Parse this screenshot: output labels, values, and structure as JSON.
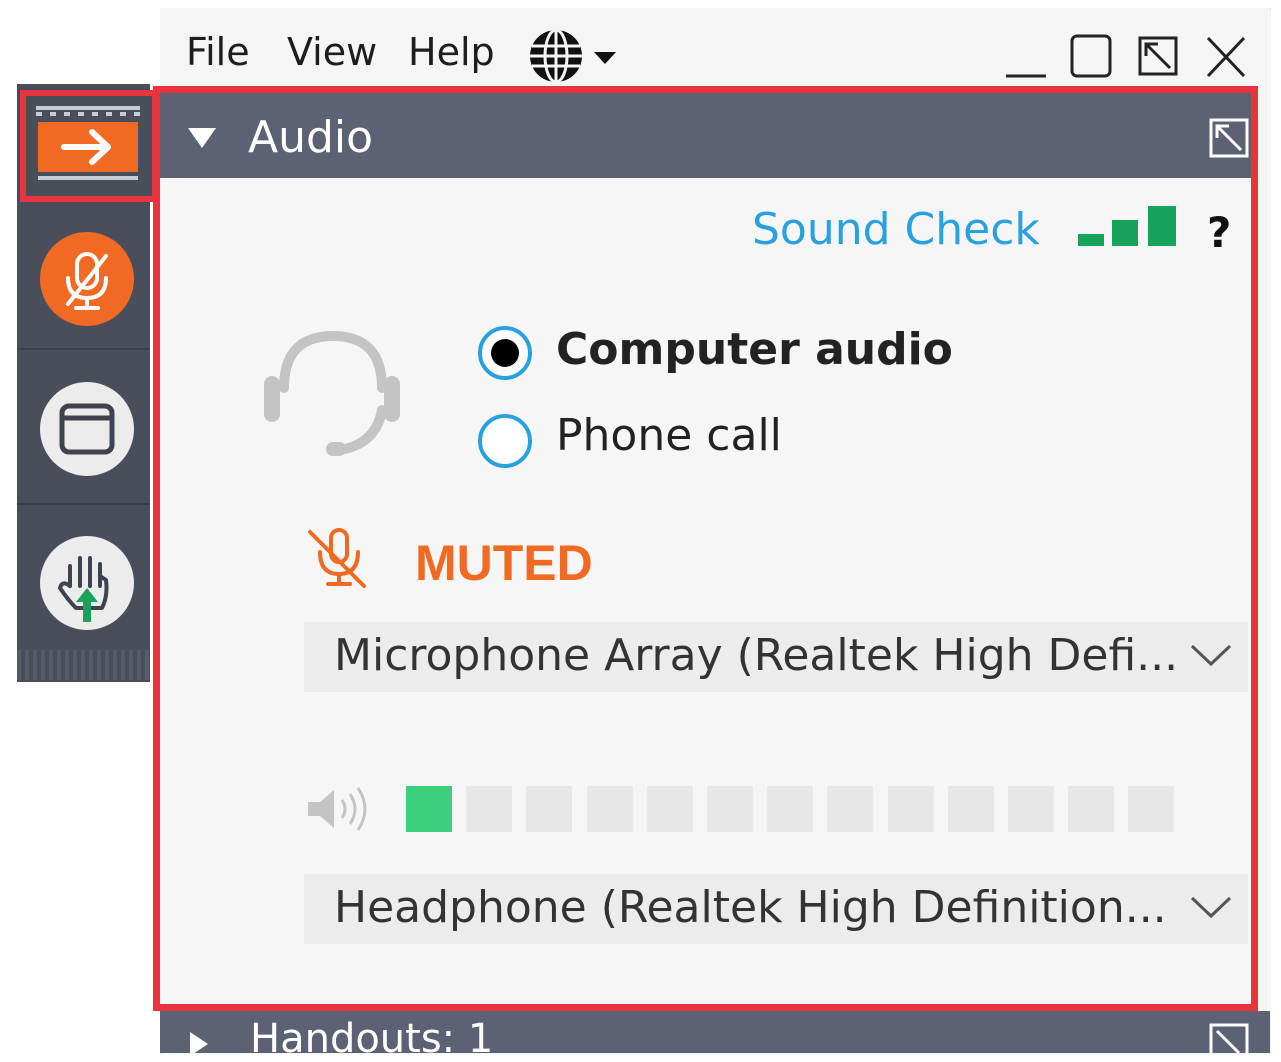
{
  "menubar": {
    "items": [
      "File",
      "View",
      "Help"
    ]
  },
  "audio_panel": {
    "title": "Audio",
    "sound_check_label": "Sound Check",
    "help_label": "?",
    "options": [
      {
        "label": "Computer audio",
        "selected": true
      },
      {
        "label": "Phone call",
        "selected": false
      }
    ],
    "mute_status": "MUTED",
    "microphone_device": "Microphone Array (Realtek High Defi...",
    "speaker_device": "Headphone (Realtek High Definition...",
    "volume_meter": {
      "active_segments": 1,
      "total_segments": 13
    }
  },
  "handouts": {
    "label": "Handouts: 1"
  },
  "colors": {
    "accent_orange": "#f06a23",
    "link_blue": "#2aa1df",
    "highlight_red": "#e8343f",
    "toolbar_bg": "#4a4e5b",
    "panel_header_bg": "#5c6273",
    "signal_green": "#19a35a"
  }
}
